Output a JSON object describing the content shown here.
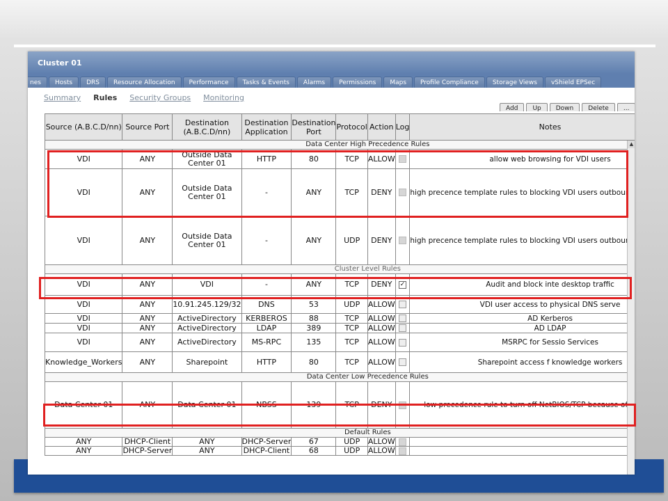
{
  "window": {
    "title": "Cluster 01"
  },
  "tabs": [
    "nes",
    "Hosts",
    "DRS",
    "Resource Allocation",
    "Performance",
    "Tasks & Events",
    "Alarms",
    "Permissions",
    "Maps",
    "Profile Compliance",
    "Storage Views",
    "vShield EPSec"
  ],
  "subtabs": [
    {
      "label": "Summary",
      "active": false
    },
    {
      "label": "Rules",
      "active": true
    },
    {
      "label": "Security Groups",
      "active": false
    },
    {
      "label": "Monitoring",
      "active": false
    }
  ],
  "toolbar": [
    "Add",
    "Up",
    "Down",
    "Delete",
    "..."
  ],
  "columns": [
    "Source (A.B.C.D/nn)",
    "Source Port",
    "Destination (A.B.C.D/nn)",
    "Destination Application",
    "Destination Port",
    "Protocol",
    "Action",
    "Log",
    "Notes"
  ],
  "sections": [
    {
      "title": "Data Center High Precedence Rules",
      "rows": [
        {
          "src": "VDI",
          "sport": "ANY",
          "dst": "Outside Data Center 01",
          "app": "HTTP",
          "dport": "80",
          "proto": "TCP",
          "action": "ALLOW",
          "log": "off",
          "notes": "allow web browsing for VDI users"
        },
        {
          "src": "VDI",
          "sport": "ANY",
          "dst": "Outside Data Center 01",
          "app": "-",
          "dport": "ANY",
          "proto": "TCP",
          "action": "DENY",
          "log": "off",
          "notes": "high precence template rules to blocking VDI users outbound to the Internet"
        },
        {
          "src": "VDI",
          "sport": "ANY",
          "dst": "Outside Data Center 01",
          "app": "-",
          "dport": "ANY",
          "proto": "UDP",
          "action": "DENY",
          "log": "off",
          "notes": "high precence template rules to blocking VDI users outbound to the Internet"
        }
      ]
    },
    {
      "title": "Cluster Level Rules",
      "rows": [
        {
          "src": "VDI",
          "sport": "ANY",
          "dst": "VDI",
          "app": "-",
          "dport": "ANY",
          "proto": "TCP",
          "action": "DENY",
          "log": "on",
          "notes": "Audit and block inte desktop traffic"
        },
        {
          "src": "VDI",
          "sport": "ANY",
          "dst": "10.91.245.129/32",
          "app": "DNS",
          "dport": "53",
          "proto": "UDP",
          "action": "ALLOW",
          "log": "empty",
          "notes": "VDI user access to physical DNS serve"
        },
        {
          "src": "VDI",
          "sport": "ANY",
          "dst": "ActiveDirectory",
          "app": "KERBEROS",
          "dport": "88",
          "proto": "TCP",
          "action": "ALLOW",
          "log": "empty",
          "notes": "AD Kerberos"
        },
        {
          "src": "VDI",
          "sport": "ANY",
          "dst": "ActiveDirectory",
          "app": "LDAP",
          "dport": "389",
          "proto": "TCP",
          "action": "ALLOW",
          "log": "empty",
          "notes": "AD LDAP"
        },
        {
          "src": "VDI",
          "sport": "ANY",
          "dst": "ActiveDirectory",
          "app": "MS-RPC",
          "dport": "135",
          "proto": "TCP",
          "action": "ALLOW",
          "log": "empty",
          "notes": "MSRPC for Sessio Services"
        },
        {
          "src": "Knowledge_Workers",
          "sport": "ANY",
          "dst": "Sharepoint",
          "app": "HTTP",
          "dport": "80",
          "proto": "TCP",
          "action": "ALLOW",
          "log": "empty",
          "notes": "Sharepoint access f knowledge workers"
        }
      ]
    },
    {
      "title": "Data Center Low Precedence Rules",
      "rows": [
        {
          "src": "Data Center 01",
          "sport": "ANY",
          "dst": "Data Center 01",
          "app": "NBSS",
          "dport": "139",
          "proto": "TCP",
          "action": "DENY",
          "log": "off",
          "notes": "low precedence rule to turn off NetBIOS/TCP because of recent worm"
        }
      ]
    },
    {
      "title": "Default Rules",
      "rows": [
        {
          "src": "ANY",
          "sport": "DHCP-Client",
          "dst": "ANY",
          "app": "DHCP-Server",
          "dport": "67",
          "proto": "UDP",
          "action": "ALLOW",
          "log": "off",
          "notes": ""
        },
        {
          "src": "ANY",
          "sport": "DHCP-Server",
          "dst": "ANY",
          "app": "DHCP-Client",
          "dport": "68",
          "proto": "UDP",
          "action": "ALLOW",
          "log": "off",
          "notes": ""
        }
      ]
    }
  ],
  "colors": {
    "slide_bar": "#1f4e96",
    "highlight": "#e02020",
    "titlebar": "#6d8bb8"
  }
}
